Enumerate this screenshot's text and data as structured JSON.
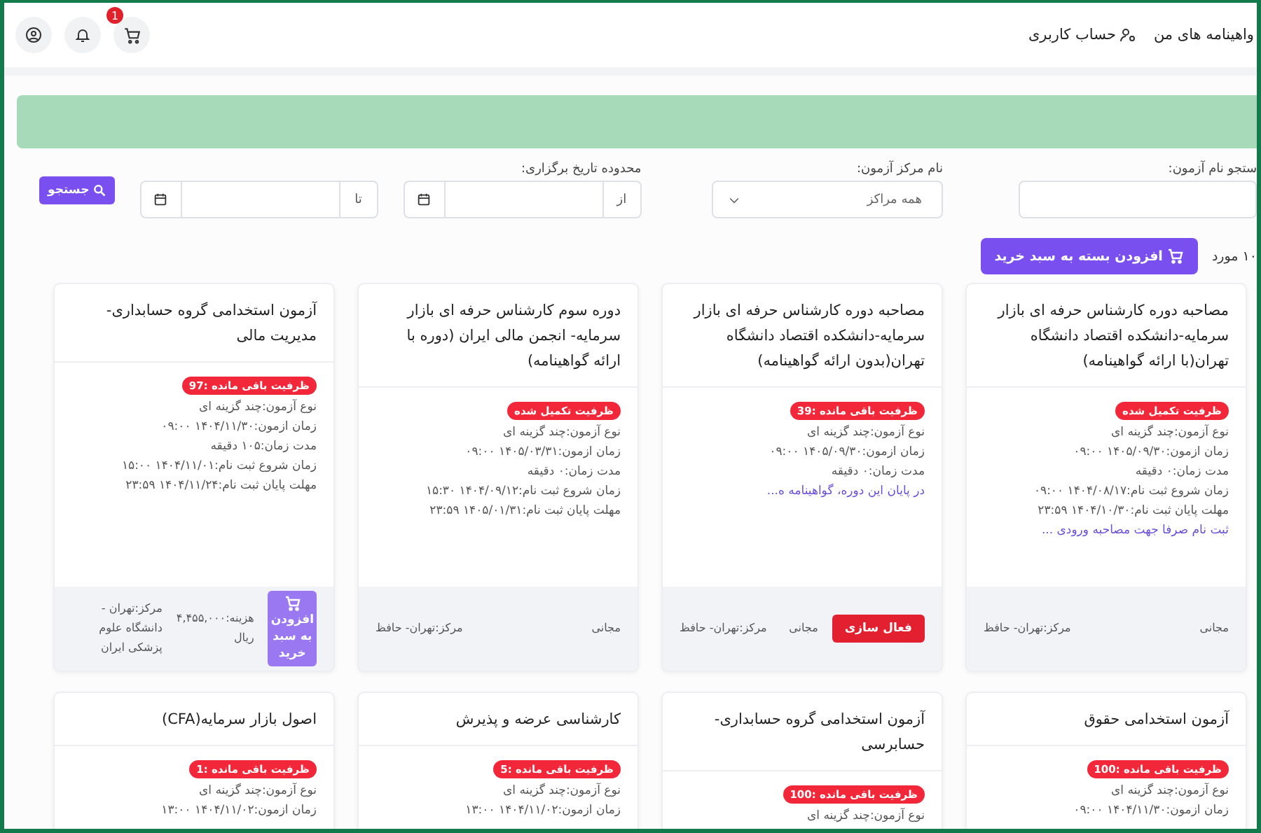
{
  "topbar": {
    "nav": [
      {
        "label": "واهینامه های من",
        "icon": false
      },
      {
        "label": "حساب کاربری",
        "icon": true
      }
    ],
    "cart_badge": "1"
  },
  "filters": {
    "exam_name": {
      "label": "ستجو نام آزمون:"
    },
    "center": {
      "label": "نام مرکز آزمون:",
      "value": "همه مراکز"
    },
    "date_range": {
      "label": "محدوده تاریخ برگزاری:",
      "from": "از",
      "to": "تا"
    },
    "search_button": "جستجو"
  },
  "result_count": "۱۰ مورد",
  "add_package_button": "افزودن بسته به سبد خرید",
  "cards": [
    {
      "title": "مصاحبه دوره کارشناس حرفه ای بازار سرمایه-دانشکده اقتصاد دانشگاه تهران(با ارائه گواهینامه)",
      "badge": "ظرفیت تکمیل شده",
      "lines": [
        "نوع آزمون:چند گزینه ای",
        "زمان ازمون:۱۴۰۵/۰۹/۳۰ ۰۹:۰۰",
        "مدت زمان:۰ دقیقه",
        "زمان شروع ثبت نام:۱۴۰۴/۰۸/۱۷ ۰۹:۰۰",
        "مهلت پایان ثبت نام:۱۴۰۴/۱۰/۳۰ ۲۳:۵۹"
      ],
      "note": "ثبت نام صرفا جهت مصاحبه ورودی ...",
      "footer": {
        "price": "مجانی",
        "center": "مرکز:تهران- حافظ"
      }
    },
    {
      "title": "مصاحبه دوره کارشناس حرفه ای بازار سرمایه-دانشکده اقتصاد دانشگاه تهران(بدون ارائه گواهینامه)",
      "badge": "ظرفیت باقی مانده :39",
      "lines": [
        "نوع آزمون:چند گزینه ای",
        "زمان ازمون:۱۴۰۵/۰۹/۳۰ ۰۹:۰۰",
        "مدت زمان:۰ دقیقه"
      ],
      "note": "در پایان این دوره، گواهینامه ه...",
      "footer": {
        "action": {
          "kind": "activate",
          "label": "فعال سازی"
        },
        "price": "مجانی",
        "center": "مرکز:تهران- حافظ"
      }
    },
    {
      "title": "دوره سوم کارشناس حرفه ای بازار سرمایه- انجمن مالی ایران (دوره با ارائه گواهینامه)",
      "badge": "ظرفیت تکمیل شده",
      "lines": [
        "نوع آزمون:چند گزینه ای",
        "زمان ازمون:۱۴۰۵/۰۳/۳۱ ۰۹:۰۰",
        "مدت زمان:۰ دقیقه",
        "زمان شروع ثبت نام:۱۴۰۴/۰۹/۱۲ ۱۵:۳۰",
        "مهلت پایان ثبت نام:۱۴۰۵/۰۱/۳۱ ۲۳:۵۹"
      ],
      "footer": {
        "price": "مجانی",
        "center": "مرکز:تهران- حافظ"
      }
    },
    {
      "title": "آزمون استخدامی گروه حسابداری-مدیریت مالی",
      "badge": "ظرفیت باقی مانده :97",
      "lines": [
        "نوع آزمون:چند گزینه ای",
        "زمان ازمون:۱۴۰۴/۱۱/۳۰ ۰۹:۰۰",
        "مدت زمان:۱۰۵ دقیقه",
        "زمان شروع ثبت نام:۱۴۰۴/۱۱/۰۱ ۱۵:۰۰",
        "مهلت پایان ثبت نام:۱۴۰۴/۱۱/۲۴ ۲۳:۵۹"
      ],
      "footer": {
        "action": {
          "kind": "cart",
          "label": "افزودن به سبد خرید"
        },
        "price": "هزینه:۴,۴۵۵,۰۰۰ ریال",
        "center": "مرکز:تهران - دانشگاه علوم پزشکی ایران"
      }
    },
    {
      "title": "آزمون استخدامی حقوق",
      "badge": "ظرفیت باقی مانده :100",
      "lines": [
        "نوع آزمون:چند گزینه ای",
        "زمان ازمون:۱۴۰۴/۱۱/۳۰ ۰۹:۰۰"
      ]
    },
    {
      "title": "آزمون استخدامی گروه حسابداری-حسابرسی",
      "badge": "ظرفیت باقی مانده :100",
      "lines": [
        "نوع آزمون:چند گزینه ای"
      ]
    },
    {
      "title": "کارشناسی عرضه و پذیرش",
      "badge": "ظرفیت باقی مانده :5",
      "lines": [
        "نوع آزمون:چند گزینه ای",
        "زمان ازمون:۱۴۰۴/۱۱/۰۲ ۱۳:۰۰"
      ]
    },
    {
      "title": "اصول بازار سرمایه(CFA)",
      "badge": "ظرفیت باقی مانده :1",
      "lines": [
        "نوع آزمون:چند گزینه ای",
        "زمان ازمون:۱۴۰۴/۱۱/۰۲ ۱۳:۰۰"
      ]
    }
  ]
}
